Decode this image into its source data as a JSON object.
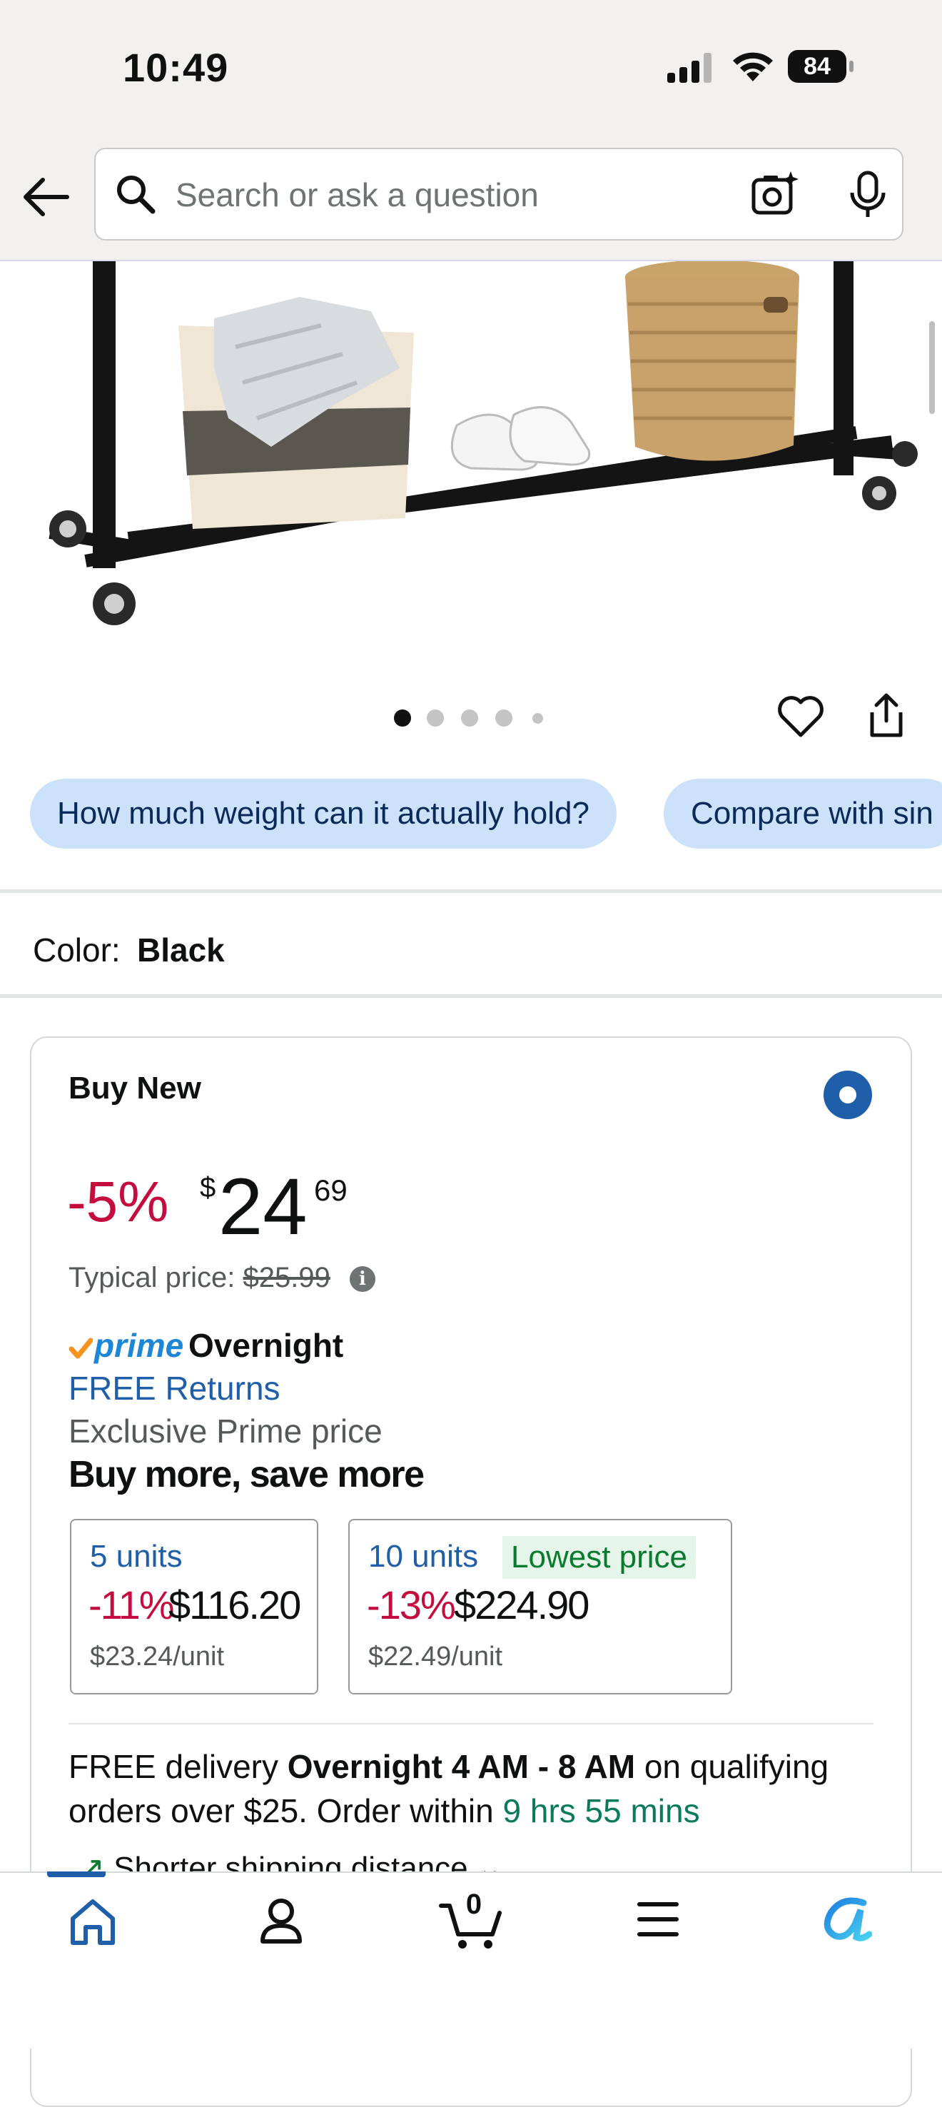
{
  "status_bar": {
    "time": "10:49",
    "battery": "84"
  },
  "search": {
    "placeholder": "Search or ask a question"
  },
  "product": {
    "image_dots_count": 5,
    "active_dot": 1
  },
  "suggestions": [
    "How much weight can it actually hold?",
    "Compare with sin"
  ],
  "color": {
    "label": "Color:",
    "value": "Black"
  },
  "buy_box": {
    "title": "Buy New",
    "discount": "-5%",
    "currency": "$",
    "price_whole": "24",
    "price_fraction": "69",
    "typical_label": "Typical price:",
    "typical_price": "$25.99",
    "info_glyph": "i",
    "prime_label": "prime",
    "prime_speed": "Overnight",
    "returns": "FREE Returns",
    "exclusive": "Exclusive Prime price",
    "buy_more": "Buy more, save more",
    "tiers": [
      {
        "units": "5 units",
        "discount": "-11%",
        "price": "$116.20",
        "per_unit": "$23.24/unit"
      },
      {
        "units": "10 units",
        "badge": "Lowest price",
        "discount": "-13%",
        "price": "$224.90",
        "per_unit": "$22.49/unit"
      }
    ],
    "delivery": {
      "prefix": "FREE delivery ",
      "window": "Overnight 4 AM - 8 AM",
      "middle": " on qualifying orders over $25. Order within ",
      "countdown": "9 hrs 55 mins"
    },
    "partial_line": "Shorter shipping distance"
  },
  "bottom_nav": {
    "cart_count": "0"
  },
  "colors": {
    "accent_blue": "#1f5ea8",
    "deal_red": "#c40c3f",
    "chip_blue": "#cce2fb",
    "prime_blue": "#1d86d6",
    "countdown_green": "#0a7a5c"
  },
  "icons": [
    "back-arrow-icon",
    "search-icon",
    "camera-icon",
    "mic-icon",
    "heart-icon",
    "share-icon",
    "info-icon",
    "prime-check-icon",
    "home-icon",
    "user-icon",
    "cart-icon",
    "menu-icon",
    "ai-assistant-icon"
  ]
}
